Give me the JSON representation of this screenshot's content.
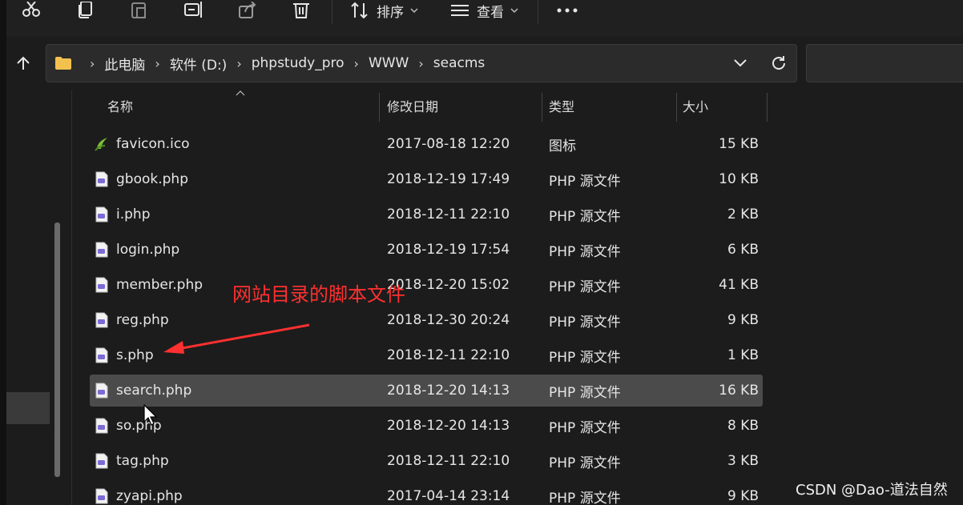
{
  "toolbar": {
    "sort_label": "排序",
    "view_label": "查看"
  },
  "address": {
    "path": [
      "此电脑",
      "软件 (D:)",
      "phpstudy_pro",
      "WWW",
      "seacms"
    ]
  },
  "columns": {
    "name": "名称",
    "date": "修改日期",
    "type": "类型",
    "size": "大小"
  },
  "files": [
    {
      "name": "favicon.ico",
      "date": "2017-08-18 12:20",
      "type": "图标",
      "size": "15 KB",
      "icon": "ico-file-icon"
    },
    {
      "name": "gbook.php",
      "date": "2018-12-19 17:49",
      "type": "PHP 源文件",
      "size": "10 KB",
      "icon": "php-file-icon"
    },
    {
      "name": "i.php",
      "date": "2018-12-11 22:10",
      "type": "PHP 源文件",
      "size": "2 KB",
      "icon": "php-file-icon"
    },
    {
      "name": "login.php",
      "date": "2018-12-19 17:54",
      "type": "PHP 源文件",
      "size": "6 KB",
      "icon": "php-file-icon"
    },
    {
      "name": "member.php",
      "date": "2018-12-20 15:02",
      "type": "PHP 源文件",
      "size": "41 KB",
      "icon": "php-file-icon"
    },
    {
      "name": "reg.php",
      "date": "2018-12-30 20:24",
      "type": "PHP 源文件",
      "size": "9 KB",
      "icon": "php-file-icon"
    },
    {
      "name": "s.php",
      "date": "2018-12-11 22:10",
      "type": "PHP 源文件",
      "size": "1 KB",
      "icon": "php-file-icon"
    },
    {
      "name": "search.php",
      "date": "2018-12-20 14:13",
      "type": "PHP 源文件",
      "size": "16 KB",
      "icon": "php-file-icon",
      "selected": true
    },
    {
      "name": "so.php",
      "date": "2018-12-20 14:13",
      "type": "PHP 源文件",
      "size": "8 KB",
      "icon": "php-file-icon"
    },
    {
      "name": "tag.php",
      "date": "2018-12-11 22:10",
      "type": "PHP 源文件",
      "size": "3 KB",
      "icon": "php-file-icon"
    },
    {
      "name": "zyapi.php",
      "date": "2017-04-14 23:14",
      "type": "PHP 源文件",
      "size": "9 KB",
      "icon": "php-file-icon"
    }
  ],
  "annotation": "网站目录的脚本文件",
  "watermark": "CSDN @Dao-道法自然",
  "colors": {
    "annotation": "#ff3030",
    "selected_row": "#4b4b4b",
    "folder": "#f2c14e",
    "php_icon": "#7b6bd6"
  }
}
